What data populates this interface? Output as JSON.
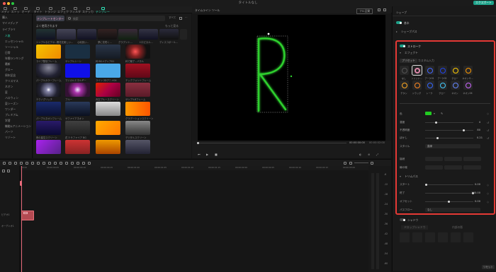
{
  "window_title": "タイトルなし",
  "menu_tabs": [
    "メディア",
    "ストック",
    "オーディオ",
    "タイトル",
    "トランジション",
    "エフェクト",
    "フィルター",
    "ステッカー",
    "テンプレート"
  ],
  "export_label": "エクスポート",
  "sidebar_items": [
    "購入",
    "マイメディア",
    "ライブラリ",
    "人気",
    "エッセンシャル",
    "ソーシャル",
    "日常",
    "年間ランキング",
    "最新",
    "グロー",
    "周年記念",
    "クリスマス",
    "ネオン",
    "夏",
    "ハロウィン",
    "夏シーズン",
    "ワンダー",
    "プレミアム",
    "学習",
    "機能&アニメーション",
    "パーツ",
    "リゾート"
  ],
  "browser": {
    "template_btn": "テンプレートセンター",
    "search_placeholder": "検索",
    "sort_label": "すべて",
    "recommended_label": "よく使用されます",
    "more_label": "もっと見る",
    "row1_caps": [
      "シンプルなビデオ...",
      "開花花美しい...",
      "心地良い...",
      "夢に花咲く...",
      "グラデント...",
      "トロピカル...",
      "ディスコボール..."
    ],
    "grid_caps": [
      [
        "ライブ配信フレーム",
        "サンプルシーン",
        "枠 BGメディア01",
        "枠で魅了...パネル"
      ],
      [
        "パープルカラーフレーム",
        "マジカルエネルギー",
        "ライン 2Dアニメ04",
        "テックフォントフレーム"
      ],
      [
        "テクノグリッチ",
        "ブルー",
        "青空ブルースクリーン",
        "サンプル8フレーム"
      ],
      [
        "パープルネオンフレーム",
        "サファイアネオン",
        "",
        "グラデーションスクリーン"
      ],
      [
        "夜の星空スクリーン",
        "花 3 サファイア BG",
        "",
        "デジタルスクリーン"
      ],
      [
        "大人の光...",
        "カラフル...",
        "シンプルな背景...",
        "グラデント 10"
      ]
    ]
  },
  "preview": {
    "header_left": "タイムライン",
    "header_mid": "ツール",
    "quality": "フル品質",
    "time_current": "00:00:00:00",
    "time_total": "00:00:02:00",
    "canvas_letter": "R"
  },
  "right_panel": {
    "tab_title": "シェープ",
    "basic_toggle_label": "基本",
    "shape_label": "シェープパス",
    "stroke_label": "ストローク",
    "effects_label": "エフェクト",
    "section_preset": "プリセット",
    "section_custom": "カスタム入力",
    "presets": [
      "なし",
      "ソリッド...",
      "アーク01",
      "アーク02",
      "グロー",
      "ネオンサ...",
      "チタン",
      "ドラッグ",
      "トーク",
      "グロー",
      "ネオン",
      "ネオン04"
    ],
    "props": [
      {
        "label": "色",
        "value": ""
      },
      {
        "label": "濃度",
        "value": "4"
      },
      {
        "label": "不透明度",
        "value": "80"
      },
      {
        "label": "ぼかし",
        "value": "0.21"
      },
      {
        "label": "スタイル",
        "value": "直線"
      },
      {
        "label": "接続",
        "value": ""
      },
      {
        "label": "線の端",
        "value": ""
      }
    ],
    "trim_label": "トリムパス",
    "trim_props": [
      {
        "label": "スタート",
        "value": "0.00"
      },
      {
        "label": "終了",
        "value": "100.00"
      },
      {
        "label": "オフセット",
        "value": "0.00"
      },
      {
        "label": "パスフロー",
        "value": "なし"
      }
    ],
    "shadow_label": "シャドウ",
    "shadow_tabs": [
      "ドロップシャドウ",
      "内部の影"
    ],
    "reset_label": "リセット",
    "stroke_color": "#22cc22"
  },
  "timeline": {
    "ruler": [
      "00:00",
      "00:00:00:05",
      "00:00:00:10",
      "00:00:00:15",
      "00:00:01:00",
      "00:00:01:05",
      "00:00:01:10",
      "00:00:01:15",
      "00:00:02:00",
      "00:00:02:05",
      "00:00:02:10",
      "00:00:02:15",
      "00:00:03:00"
    ],
    "track_labels": [
      "ビデオ1",
      "オーディオ1"
    ],
    "meter_ticks": [
      "-6",
      "-12",
      "-18",
      "-24",
      "-30",
      "-36",
      "-42",
      "-48",
      "-54",
      "-60"
    ]
  }
}
